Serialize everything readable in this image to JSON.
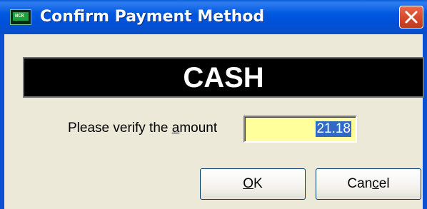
{
  "window": {
    "title": "Confirm Payment Method",
    "icon": "pos-terminal-icon",
    "close_icon": "close-x-icon"
  },
  "payment": {
    "method": "CASH"
  },
  "verify": {
    "label_before": "Please verify the ",
    "label_accel": "a",
    "label_after": "mount",
    "amount_value": "21.18",
    "amount_field_color": "#ffff9c",
    "selection_color": "#316ac5"
  },
  "buttons": {
    "ok_accel": "O",
    "ok_rest": "K",
    "cancel_before": "Can",
    "cancel_accel": "c",
    "cancel_after": "el"
  }
}
